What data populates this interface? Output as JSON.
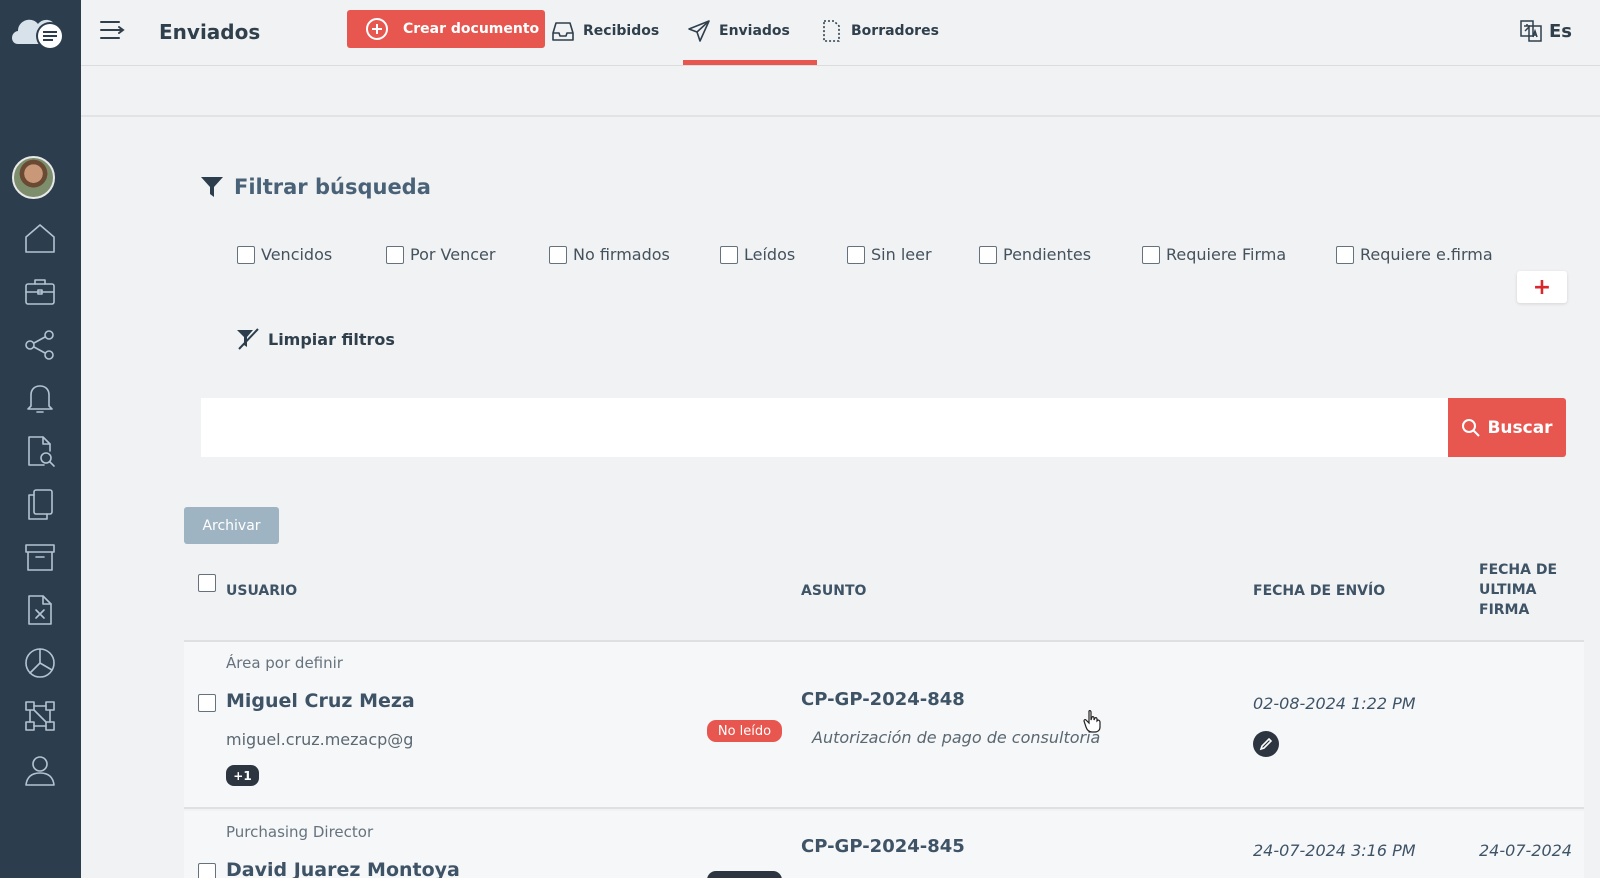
{
  "header": {
    "title": "Enviados",
    "create_label": "Crear documento",
    "tabs": [
      {
        "label": "Recibidos",
        "icon": "inbox-icon"
      },
      {
        "label": "Enviados",
        "icon": "send-icon",
        "active": true
      },
      {
        "label": "Borradores",
        "icon": "draft-icon"
      }
    ],
    "language": "Es"
  },
  "sidebar": {
    "items": [
      {
        "name": "home-icon"
      },
      {
        "name": "briefcase-icon"
      },
      {
        "name": "share-icon"
      },
      {
        "name": "bell-icon"
      },
      {
        "name": "document-search-icon"
      },
      {
        "name": "copy-icon"
      },
      {
        "name": "archive-icon"
      },
      {
        "name": "document-cancel-icon"
      },
      {
        "name": "pie-chart-icon"
      },
      {
        "name": "workflow-icon"
      },
      {
        "name": "user-icon"
      }
    ]
  },
  "filters": {
    "title": "Filtrar búsqueda",
    "options": [
      "Vencidos",
      "Por Vencer",
      "No firmados",
      "Leídos",
      "Sin leer",
      "Pendientes",
      "Requiere Firma",
      "Requiere e.firma"
    ],
    "add_label": "+",
    "clear_label": "Limpiar filtros"
  },
  "search": {
    "value": "",
    "button_label": "Buscar"
  },
  "actions": {
    "archive_label": "Archivar"
  },
  "table": {
    "columns": {
      "user": "USUARIO",
      "subject": "ASUNTO",
      "sent_date": "FECHA DE ENVÍO",
      "last_signature_line1": "FECHA DE",
      "last_signature_line2": "ULTIMA",
      "last_signature_line3": "FIRMA"
    },
    "rows": [
      {
        "area": "Área por definir",
        "name": "Miguel Cruz Meza",
        "email": "miguel.cruz.mezacp@g",
        "extra": "+1",
        "status": "No leído",
        "code": "CP-GP-2024-848",
        "subject": "Autorización de pago de consultoría",
        "sent_date": "02-08-2024 1:22 PM",
        "last_signature": ""
      },
      {
        "area": "Purchasing Director",
        "name": "David Juarez Montoya",
        "code": "CP-GP-2024-845",
        "sent_date": "24-07-2024 3:16 PM",
        "last_signature": "24-07-2024"
      }
    ]
  },
  "colors": {
    "accent": "#e8574f",
    "sidebar": "#2c3e4e",
    "archive_button": "#9fb4c2"
  }
}
